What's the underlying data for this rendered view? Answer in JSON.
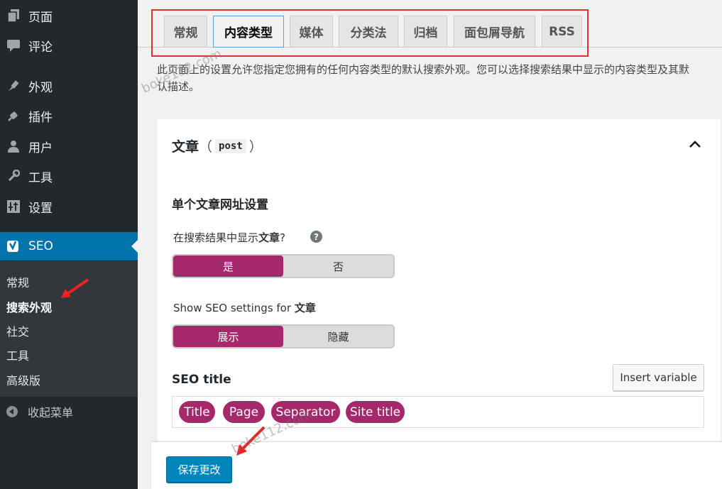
{
  "sidebar": {
    "items": [
      {
        "label": "页面",
        "icon": "pages-icon"
      },
      {
        "label": "评论",
        "icon": "comments-icon"
      },
      {
        "label": "外观",
        "icon": "appearance-icon"
      },
      {
        "label": "插件",
        "icon": "plugins-icon"
      },
      {
        "label": "用户",
        "icon": "users-icon"
      },
      {
        "label": "工具",
        "icon": "tools-icon"
      },
      {
        "label": "设置",
        "icon": "settings-icon"
      },
      {
        "label": "SEO",
        "icon": "yoast-icon"
      }
    ],
    "submenu": [
      "常规",
      "搜索外观",
      "社交",
      "工具",
      "高级版"
    ],
    "current_sub": "搜索外观",
    "collapse_label": "收起菜单"
  },
  "tabs": [
    "常规",
    "内容类型",
    "媒体",
    "分类法",
    "归档",
    "面包屑导航",
    "RSS"
  ],
  "active_tab": "内容类型",
  "description": "此页面上的设置允许您指定您拥有的任何内容类型的默认搜索外观。您可以选择搜索结果中显示的内容类型及其默认描述。",
  "panel": {
    "title": "文章",
    "paren_open": "（",
    "post_type_code": "post",
    "paren_close": "）",
    "section_title": "单个文章网址设置",
    "show_in_results": {
      "label_prefix": "在搜索结果中显示",
      "label_bold": "文章",
      "label_suffix": "?",
      "help": "?",
      "options": [
        "是",
        "否"
      ],
      "selected": "是"
    },
    "show_seo_settings": {
      "label_prefix": "Show SEO settings for",
      "label_bold": "文章",
      "options": [
        "展示",
        "隐藏"
      ],
      "selected": "展示"
    },
    "seo_title": {
      "label": "SEO title",
      "insert_button": "Insert variable",
      "variables": [
        "Title",
        "Page",
        "Separator",
        "Site title"
      ]
    }
  },
  "footer": {
    "save_label": "保存更改"
  },
  "watermark": "boke112.com",
  "colors": {
    "sidebar_bg": "#23282d",
    "seo_active": "#0073aa",
    "yoast_purple": "#a4286a",
    "save_button": "#0085ba",
    "annotation_red": "#dd3333"
  }
}
